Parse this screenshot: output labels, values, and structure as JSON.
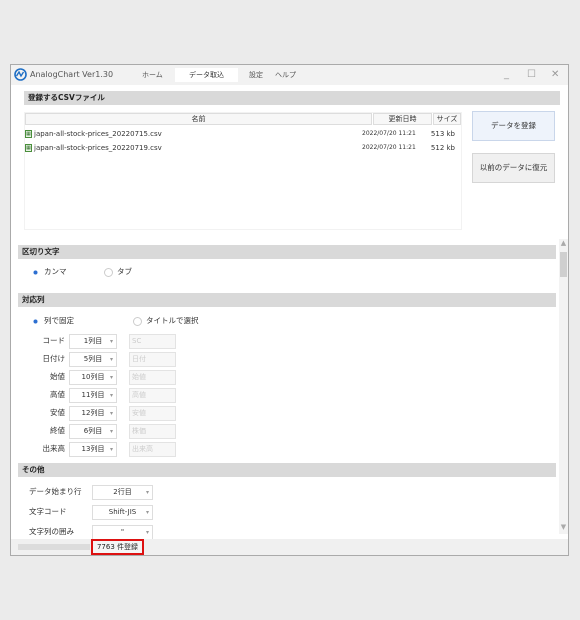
{
  "app": {
    "title": "AnalogChart Ver1.30"
  },
  "tabs": [
    {
      "label": "ホーム",
      "active": false
    },
    {
      "label": "データ取込",
      "active": true
    },
    {
      "label": "設定",
      "active": false
    },
    {
      "label": "ヘルプ",
      "active": false
    }
  ],
  "window_controls": {
    "minimize": "_",
    "maximize": "☐",
    "close": "✕"
  },
  "csv_section": {
    "title": "登録するCSVファイル",
    "columns": [
      "名前",
      "更新日時",
      "サイズ"
    ],
    "files": [
      {
        "name": "japan-all-stock-prices_20220715.csv",
        "date": "2022/07/20 11:21",
        "size": "513 kb"
      },
      {
        "name": "japan-all-stock-prices_20220719.csv",
        "date": "2022/07/20 11:21",
        "size": "512 kb"
      }
    ]
  },
  "buttons": {
    "register": "データを登録",
    "restore": "以前のデータに復元"
  },
  "delimiter": {
    "title": "区切り文字",
    "options": [
      {
        "label": "カンマ",
        "selected": true
      },
      {
        "label": "タブ",
        "selected": false
      }
    ]
  },
  "mapping": {
    "title": "対応列",
    "modes": [
      {
        "label": "列で固定",
        "selected": true
      },
      {
        "label": "タイトルで選択",
        "selected": false
      }
    ],
    "rows": [
      {
        "label": "コード",
        "column": "1列目",
        "title": "SC"
      },
      {
        "label": "日付け",
        "column": "5列目",
        "title": "日付"
      },
      {
        "label": "始値",
        "column": "10列目",
        "title": "始値"
      },
      {
        "label": "高値",
        "column": "11列目",
        "title": "高値"
      },
      {
        "label": "安値",
        "column": "12列目",
        "title": "安値"
      },
      {
        "label": "終値",
        "column": "6列目",
        "title": "株価"
      },
      {
        "label": "出来高",
        "column": "13列目",
        "title": "出来高"
      }
    ]
  },
  "other": {
    "title": "その他",
    "rows": [
      {
        "label": "データ始まり行",
        "value": "2行目"
      },
      {
        "label": "文字コード",
        "value": "Shift-JIS"
      },
      {
        "label": "文字列の囲み",
        "value": "\""
      }
    ]
  },
  "status": {
    "text": "7763 件登録"
  },
  "colors": {
    "accent": "#2c6fd1",
    "logo": "#1f6fc5",
    "status_border": "#dd1111",
    "file_icon": "#4a8f3c"
  },
  "icons": {
    "logo": "analogchart-logo-icon",
    "file": "csv-file-icon",
    "caret": "chevron-down-icon"
  }
}
